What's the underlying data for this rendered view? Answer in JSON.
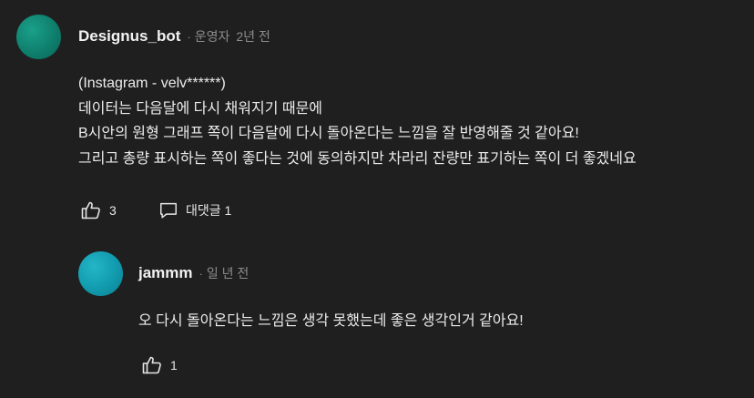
{
  "comment": {
    "author": "Designus_bot",
    "separator": "·",
    "role": "운영자",
    "time": "2년 전",
    "lines": [
      "(Instagram - velv******)",
      "데이터는 다음달에 다시 채워지기 때문에",
      "B시안의 원형 그래프 쪽이 다음달에 다시 돌아온다는 느낌을 잘 반영해줄 것 같아요!",
      "그리고 총량 표시하는 쪽이 좋다는 것에 동의하지만 차라리 잔량만 표기하는 쪽이 더 좋겠네요"
    ],
    "like_count": "3",
    "reply_label": "대댓글 1",
    "like_icon": "thumbs-up-icon",
    "reply_icon": "comment-bubble-icon"
  },
  "reply": {
    "author": "jammm",
    "separator": "·",
    "time": "일 년 전",
    "lines": [
      "오 다시 돌아온다는 느낌은 생각 못했는데 좋은 생각인거 같아요!"
    ],
    "like_count": "1",
    "like_icon": "thumbs-up-icon"
  },
  "colors": {
    "background": "#1f1f1f",
    "text": "#ececec",
    "muted": "#8c8c8c",
    "avatar_main": "#128a76",
    "avatar_reply": "#16a3b6"
  }
}
